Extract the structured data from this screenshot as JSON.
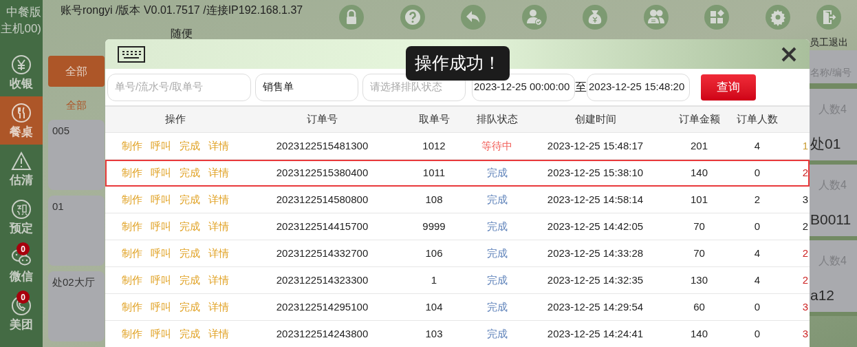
{
  "sidebar": {
    "brand_lines": [
      "中餐版",
      "主机00)"
    ],
    "items": [
      {
        "label": "收银",
        "selected": false
      },
      {
        "label": "餐桌",
        "selected": true
      },
      {
        "label": "估清",
        "selected": false
      },
      {
        "label": "预定",
        "selected": false
      },
      {
        "label": "微信",
        "selected": false,
        "badge": "0"
      },
      {
        "label": "美团",
        "selected": false,
        "badge": "0"
      }
    ]
  },
  "header": {
    "info": "账号rongyi /版本 V0.01.7517 /连接IP192.168.1.37",
    "subtitle": "随便"
  },
  "toolbar": {
    "exit_label": "员工退出"
  },
  "left_panel": {
    "tab": "全部",
    "subtab": "全部",
    "tables": [
      "005",
      "01",
      "处02大厅"
    ]
  },
  "right_panel": {
    "search_placeholder": "名称/编号",
    "cards": [
      {
        "people": "人数4",
        "name": "处01"
      },
      {
        "people": "人数4",
        "name": "B0011"
      },
      {
        "people": "人数4",
        "name": "a12"
      }
    ]
  },
  "dialog": {
    "filters": {
      "number_placeholder": "单号/流水号/取单号",
      "order_type": "销售单",
      "status_placeholder": "请选择排队状态",
      "date_from": "2023-12-25 00:00:00",
      "separator": "至",
      "date_to": "2023-12-25 15:48:20",
      "query_button": "查询"
    },
    "table": {
      "columns": [
        "操作",
        "订单号",
        "取单号",
        "排队状态",
        "创建时间",
        "订单金额",
        "订单人数"
      ],
      "rows": [
        {
          "actions": [
            "制作",
            "呼叫",
            "完成",
            "详情"
          ],
          "order_no": "2023122515481300",
          "pickup_no": "1012",
          "status": "等待中",
          "kind": "waiting",
          "created": "2023-12-25 15:48:17",
          "amount": "201",
          "people": "4",
          "column_8": "1",
          "color": "#c89a2e",
          "selected": false
        },
        {
          "actions": [
            "制作",
            "呼叫",
            "完成",
            "详情"
          ],
          "order_no": "2023122515380400",
          "pickup_no": "1011",
          "status": "完成",
          "kind": "done",
          "created": "2023-12-25 15:38:10",
          "amount": "140",
          "people": "0",
          "column_8": "2",
          "color": "#cc1f1f",
          "selected": true
        },
        {
          "actions": [
            "制作",
            "呼叫",
            "完成",
            "详情"
          ],
          "order_no": "2023122514580800",
          "pickup_no": "108",
          "status": "完成",
          "kind": "done",
          "created": "2023-12-25 14:58:14",
          "amount": "101",
          "people": "2",
          "column_8": "3",
          "color": "#222222",
          "selected": false
        },
        {
          "actions": [
            "制作",
            "呼叫",
            "完成",
            "详情"
          ],
          "order_no": "2023122514415700",
          "pickup_no": "9999",
          "status": "完成",
          "kind": "done",
          "created": "2023-12-25 14:42:05",
          "amount": "70",
          "people": "0",
          "column_8": "2",
          "color": "#222222",
          "selected": false
        },
        {
          "actions": [
            "制作",
            "呼叫",
            "完成",
            "详情"
          ],
          "order_no": "2023122514332700",
          "pickup_no": "106",
          "status": "完成",
          "kind": "done",
          "created": "2023-12-25 14:33:28",
          "amount": "70",
          "people": "4",
          "column_8": "2",
          "color": "#cc1f1f",
          "selected": false
        },
        {
          "actions": [
            "制作",
            "呼叫",
            "完成",
            "详情"
          ],
          "order_no": "2023122514323300",
          "pickup_no": "1",
          "status": "完成",
          "kind": "done",
          "created": "2023-12-25 14:32:35",
          "amount": "130",
          "people": "4",
          "column_8": "2",
          "color": "#cc1f1f",
          "selected": false
        },
        {
          "actions": [
            "制作",
            "呼叫",
            "完成",
            "详情"
          ],
          "order_no": "2023122514295100",
          "pickup_no": "104",
          "status": "完成",
          "kind": "done",
          "created": "2023-12-25 14:29:54",
          "amount": "60",
          "people": "0",
          "column_8": "3",
          "color": "#cc1f1f",
          "selected": false
        },
        {
          "actions": [
            "制作",
            "呼叫",
            "完成",
            "详情"
          ],
          "order_no": "2023122514243800",
          "pickup_no": "103",
          "status": "完成",
          "kind": "done",
          "created": "2023-12-25 14:24:41",
          "amount": "140",
          "people": "0",
          "column_8": "3",
          "color": "#cc1f1f",
          "selected": false
        }
      ]
    }
  },
  "toast": "操作成功！"
}
